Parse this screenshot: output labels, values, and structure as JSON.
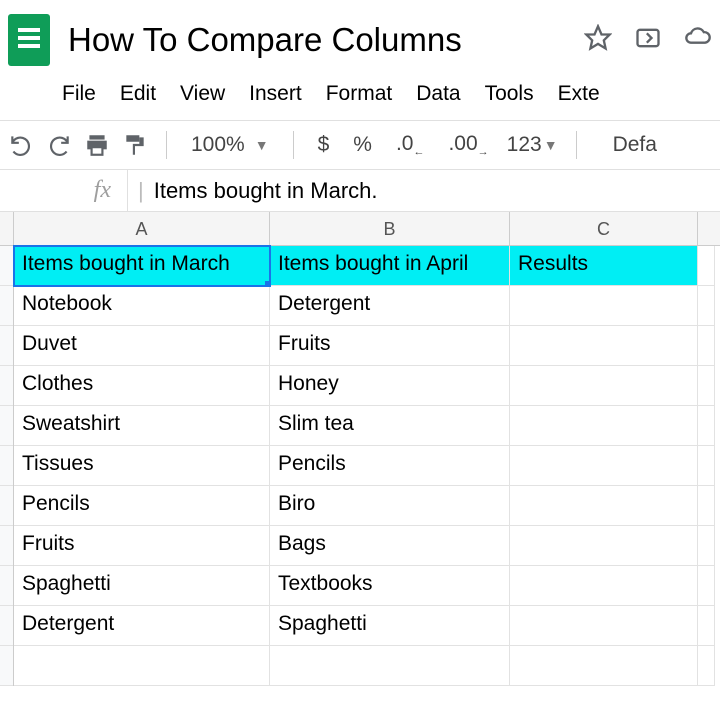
{
  "doc": {
    "title": "How To Compare Columns"
  },
  "menu": {
    "file": "File",
    "edit": "Edit",
    "view": "View",
    "insert": "Insert",
    "format": "Format",
    "data": "Data",
    "tools": "Tools",
    "exte": "Exte"
  },
  "toolbar": {
    "zoom": "100%",
    "currency": "$",
    "percent": "%",
    "dec_dec": ".0",
    "inc_dec": ".00",
    "numfmt": "123",
    "font": "Defa"
  },
  "formula_bar": {
    "label": "fx",
    "value": "Items bought in March."
  },
  "columns": {
    "A": "A",
    "B": "B",
    "C": "C"
  },
  "headers": {
    "A": "Items bought in March",
    "B": "Items bought in April",
    "C": "Results"
  },
  "rows": [
    {
      "A": "Notebook",
      "B": "Detergent",
      "C": ""
    },
    {
      "A": "Duvet",
      "B": "Fruits",
      "C": ""
    },
    {
      "A": "Clothes",
      "B": "Honey",
      "C": ""
    },
    {
      "A": "Sweatshirt",
      "B": "Slim tea",
      "C": ""
    },
    {
      "A": "Tissues",
      "B": "Pencils",
      "C": ""
    },
    {
      "A": "Pencils",
      "B": "Biro",
      "C": ""
    },
    {
      "A": "Fruits",
      "B": "Bags",
      "C": ""
    },
    {
      "A": "Spaghetti",
      "B": "Textbooks",
      "C": ""
    },
    {
      "A": "Detergent",
      "B": "Spaghetti",
      "C": ""
    },
    {
      "A": "",
      "B": "",
      "C": ""
    }
  ]
}
